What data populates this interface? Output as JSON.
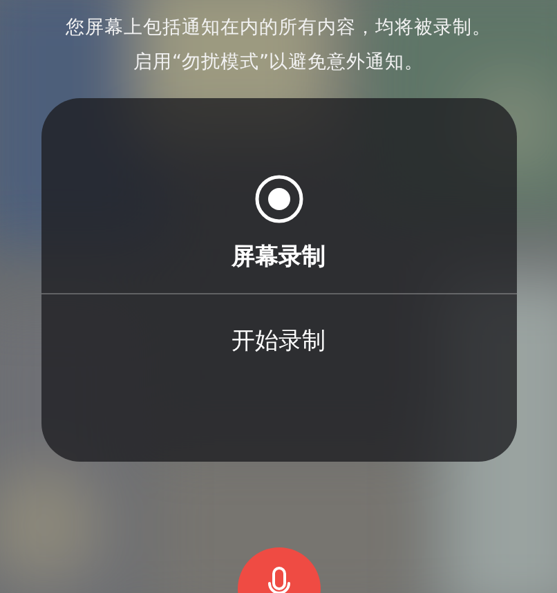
{
  "notice": {
    "lines": [
      "您屏幕上包括通知在内的所有内容，均将被录制。",
      "启用“勿扰模式”以避免意外通知。"
    ]
  },
  "panel": {
    "title": "屏幕录制",
    "recording": false,
    "action": "开始录制"
  },
  "microphone": {
    "on": true
  }
}
